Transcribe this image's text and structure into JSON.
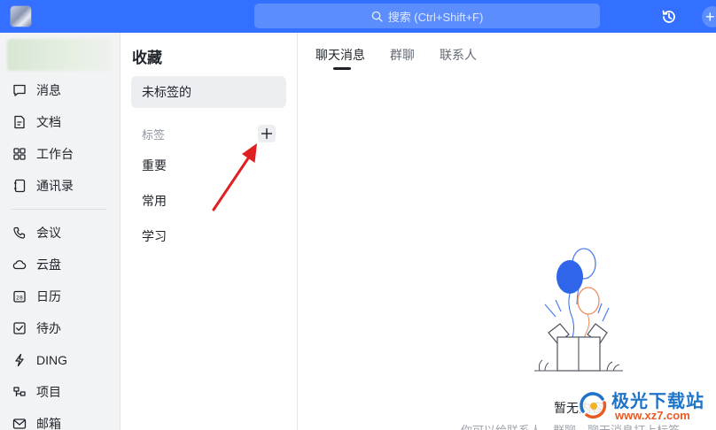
{
  "topbar": {
    "search_placeholder": "搜索 (Ctrl+Shift+F)",
    "accent_color": "#3370ff",
    "icons": [
      "search-icon",
      "history-icon",
      "plus-icon"
    ]
  },
  "sidebar": {
    "items": [
      {
        "label": "消息",
        "icon": "message-icon"
      },
      {
        "label": "文档",
        "icon": "document-icon"
      },
      {
        "label": "工作台",
        "icon": "workbench-icon"
      },
      {
        "label": "通讯录",
        "icon": "contacts-icon"
      },
      {
        "label": "会议",
        "icon": "meeting-icon"
      },
      {
        "label": "云盘",
        "icon": "cloud-icon"
      },
      {
        "label": "日历",
        "icon": "calendar-icon"
      },
      {
        "label": "待办",
        "icon": "todo-icon"
      },
      {
        "label": "DING",
        "icon": "ding-icon"
      },
      {
        "label": "项目",
        "icon": "project-icon"
      },
      {
        "label": "邮箱",
        "icon": "mail-icon"
      }
    ],
    "calendar_day": "28"
  },
  "favorites": {
    "title": "收藏",
    "untagged": "未标签的",
    "tags_header": "标签",
    "tags": [
      "重要",
      "常用",
      "学习"
    ]
  },
  "main": {
    "tabs": [
      {
        "label": "聊天消息",
        "active": true
      },
      {
        "label": "群聊",
        "active": false
      },
      {
        "label": "联系人",
        "active": false
      }
    ],
    "empty_text": "暂无内容",
    "empty_subtext": "你可以给联系人、群聊、聊天消息打上标签"
  },
  "watermark": {
    "name": "极光下载站",
    "url": "www.xz7.com"
  }
}
